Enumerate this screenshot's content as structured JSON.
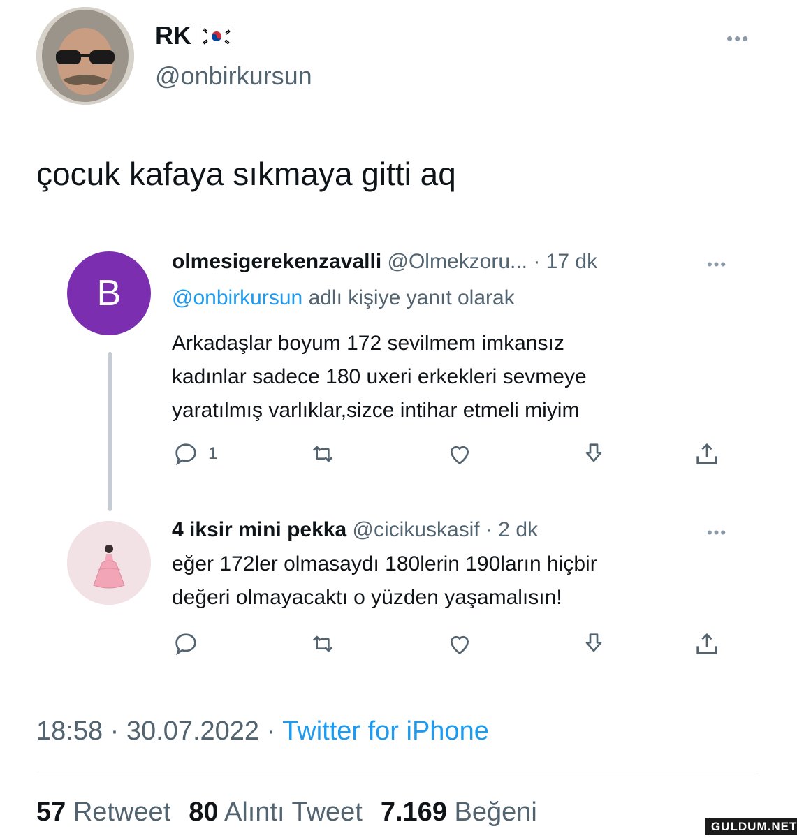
{
  "author": {
    "name": "RK",
    "handle": "@onbirkursun"
  },
  "tweet": {
    "text": "çocuk kafaya sıkmaya gitti aq"
  },
  "reply1": {
    "avatar_letter": "B",
    "name": "olmesigerekenzavalli",
    "handle": "@Olmekzoru...",
    "time": "· 17 dk",
    "reply_prefix": "@onbirkursun",
    "reply_suffix": "adlı kişiye yanıt olarak",
    "lines": [
      "Arkadaşlar boyum 172 sevilmem imkansız",
      "kadınlar sadece 180 uxeri erkekleri sevmeye",
      "yaratılmış varlıklar,sizce intihar etmeli miyim"
    ],
    "reply_count": "1"
  },
  "reply2": {
    "name": "4 iksir mini pekka",
    "handle": "@cicikuskasif",
    "time": "· 2 dk",
    "lines": [
      "eğer 172ler olmasaydı 180lerin 190ların hiçbir",
      "değeri olmayacaktı o yüzden yaşamalısın!"
    ]
  },
  "meta": {
    "time": "18:58",
    "date": "30.07.2022",
    "sep": "·",
    "source": "Twitter for iPhone"
  },
  "stats": {
    "retweets": "57",
    "retweets_label": "Retweet",
    "quotes": "80",
    "quotes_label": "Alıntı Tweet",
    "likes": "7.169",
    "likes_label": "Beğeni"
  },
  "watermark": "GULDUM.NET",
  "colors": {
    "link": "#1d9bf0",
    "avatar_b": "#7b2fb0",
    "muted": "#536471"
  }
}
